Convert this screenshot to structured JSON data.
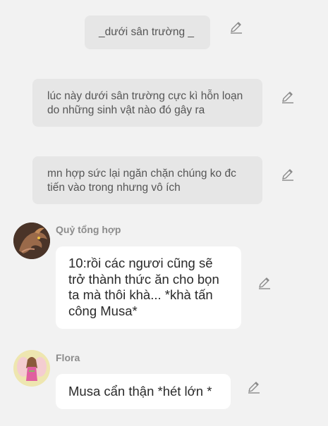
{
  "messages": [
    {
      "type": "narration",
      "text": "_dưới sân trường _"
    },
    {
      "type": "narration",
      "text": "lúc này dưới sân trường cực kì hỗn loạn do những sinh vật nào đó gây ra"
    },
    {
      "type": "narration",
      "text": "mn hợp sức lại ngăn chặn chúng ko đc tiến vào trong nhưng vô ích"
    },
    {
      "type": "character",
      "name": "Quỷ tổng hợp",
      "avatar": "dragon-avatar",
      "text": "10:rồi các ngươi cũng sẽ trở thành thức ăn cho bọn ta mà thôi khà... *khà tấn công Musa*"
    },
    {
      "type": "character",
      "name": "Flora",
      "avatar": "flora-avatar",
      "text": "Musa cẩn thận *hét lớn *"
    }
  ],
  "icons": {
    "edit": "pencil-icon"
  },
  "colors": {
    "background": "#f2f2f2",
    "narration_bg": "#e6e6e6",
    "bubble_bg": "#ffffff",
    "name_text": "#8c8c8c",
    "icon": "#8a8a8a"
  }
}
